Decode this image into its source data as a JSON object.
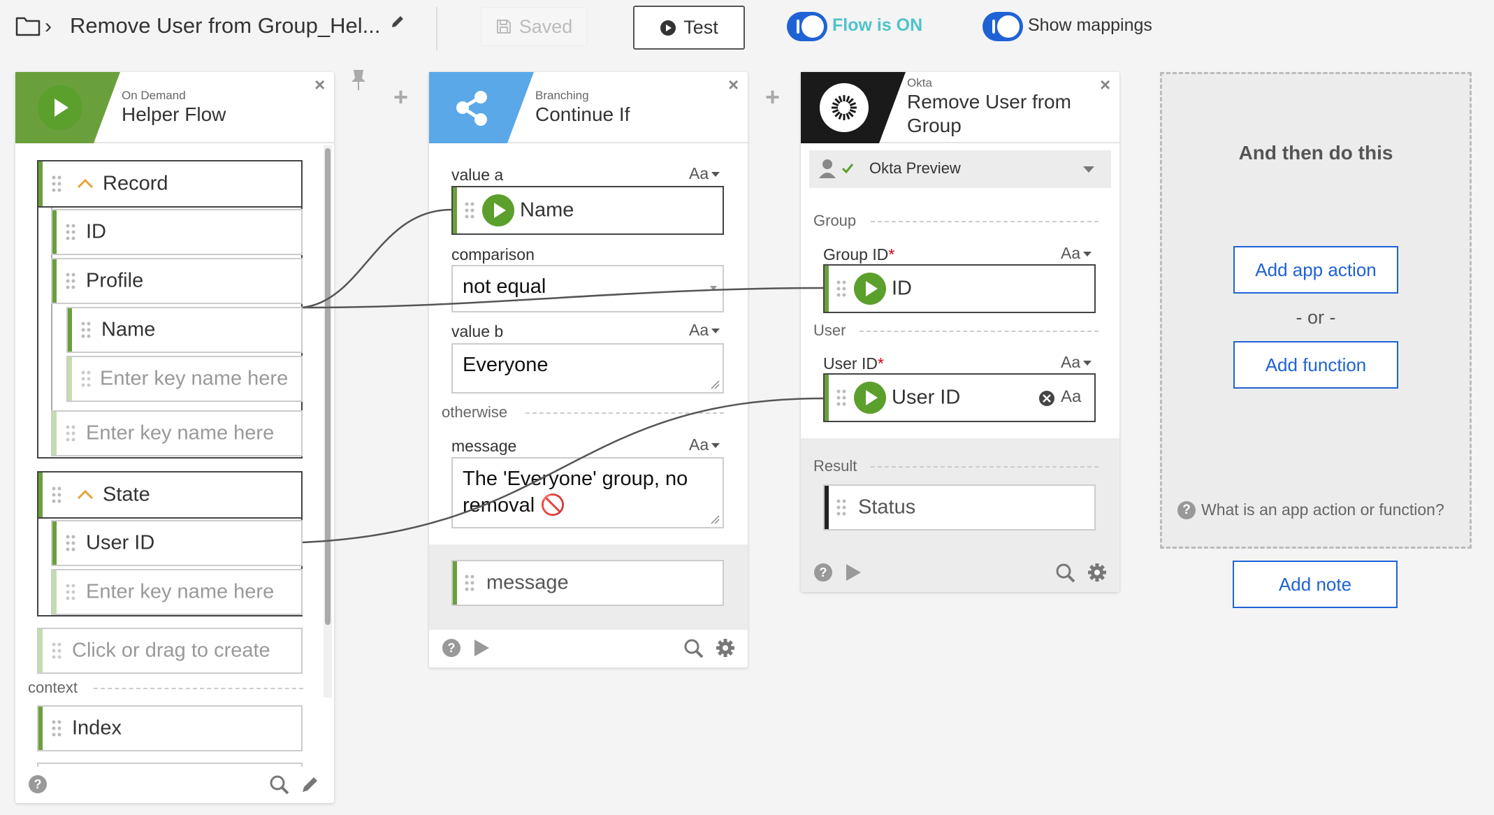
{
  "header": {
    "flow_title": "Remove User from Group_Hel...",
    "saved_label": "Saved",
    "test_label": "Test",
    "flow_on_label": "Flow is ON",
    "show_mappings_label": "Show mappings"
  },
  "helper_card": {
    "subtitle": "On Demand",
    "title": "Helper Flow",
    "record_label": "Record",
    "id_label": "ID",
    "profile_label": "Profile",
    "name_label": "Name",
    "key_placeholder_nested": "Enter key name here",
    "key_placeholder_record": "Enter key name here",
    "state_label": "State",
    "user_id_label": "User ID",
    "key_placeholder_state": "Enter key name here",
    "create_placeholder": "Click or drag to create",
    "context_label": "context",
    "index_label": "Index"
  },
  "branch_card": {
    "subtitle": "Branching",
    "title": "Continue If",
    "value_a_label": "value a",
    "value_a_type": "Aa",
    "value_a_chip": "Name",
    "comparison_label": "comparison",
    "comparison_value": "not equal",
    "value_b_label": "value b",
    "value_b_type": "Aa",
    "value_b_value": "Everyone",
    "otherwise_label": "otherwise",
    "message_label": "message",
    "message_type": "Aa",
    "message_value": "The 'Everyone' group, no removal 🚫",
    "output_message": "message"
  },
  "okta_card": {
    "subtitle": "Okta",
    "title": "Remove User from Group",
    "connection": "Okta Preview",
    "group_section": "Group",
    "group_id_label": "Group ID",
    "group_id_type": "Aa",
    "group_id_chip": "ID",
    "user_section": "User",
    "user_id_label": "User ID",
    "user_id_type": "Aa",
    "user_id_chip": "User ID",
    "user_id_chip_type": "Aa",
    "result_section": "Result",
    "status_label": "Status",
    "required_mark": "*"
  },
  "next_panel": {
    "title": "And then do this",
    "add_app_action": "Add app action",
    "or_text": "- or -",
    "add_function": "Add function",
    "help_text": "What is an app action or function?",
    "add_note": "Add note"
  },
  "colors": {
    "accent_blue": "#1f62d6",
    "flow_on_teal": "#4fc3c9",
    "helper_green": "#6aa03c",
    "branch_blue": "#5aa8e8",
    "okta_black": "#1a1a1a"
  },
  "icons": [
    "folder-icon",
    "chevron-right-icon",
    "pencil-icon",
    "save-icon",
    "play-icon",
    "share-icon",
    "okta-logo-icon",
    "user-icon",
    "check-icon",
    "help-icon",
    "search-icon",
    "gear-icon",
    "pin-icon",
    "close-icon",
    "clear-icon"
  ]
}
